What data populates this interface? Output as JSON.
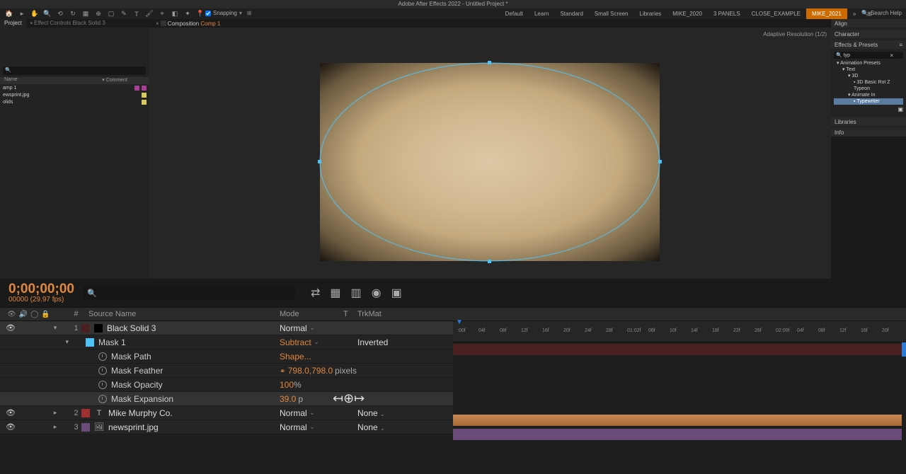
{
  "app": {
    "title": "Adobe After Effects 2022 - Untitled Project *"
  },
  "snapping": {
    "label": "Snapping"
  },
  "workspaces": [
    "Default",
    "Learn",
    "Standard",
    "Small Screen",
    "Libraries",
    "MIKE_2020",
    "3 PANELS",
    "CLOSE_EXAMPLE",
    "MIKE_2021"
  ],
  "search_help": {
    "placeholder": "Search Help"
  },
  "panel_tabs": {
    "project": "Project",
    "effect_controls": "Effect Controls Black Solid 3"
  },
  "comp_tab": {
    "prefix": "Composition",
    "name": "Comp 1"
  },
  "adaptive": "Adaptive Resolution (1/2)",
  "project": {
    "cols": {
      "name": "Name",
      "type": "Comment"
    },
    "items": [
      {
        "name": "amp 1",
        "color": "#a94097"
      },
      {
        "name": "ewsprint.jpg",
        "color": "#d9c85a"
      },
      {
        "name": "olids",
        "color": "#d9c85a"
      }
    ]
  },
  "rcol": {
    "align": "Align",
    "character": "Character",
    "effects": "Effects & Presets",
    "search": "typ",
    "tree": {
      "root": "Animation Presets",
      "text": "Text",
      "threeD": "3D",
      "threeD_item": "3D Basic Rot Z Typeon",
      "animate_in": "Animate In",
      "typewriter": "Typewriter"
    },
    "libraries": "Libraries",
    "info": "Info"
  },
  "timeline_head": {
    "timecode": "0;00;00;00",
    "sub": "00000 (29.97 fps)"
  },
  "col_headers": {
    "num": "#",
    "source": "Source Name",
    "mode": "Mode",
    "t": "T",
    "trkmat": "TrkMat"
  },
  "layers": [
    {
      "num": "1",
      "name": "Black Solid 3",
      "mode": "Normal"
    },
    {
      "mask_name": "Mask 1",
      "mask_mode": "Subtract",
      "inverted": "Inverted"
    }
  ],
  "props": {
    "path": {
      "label": "Mask Path",
      "value": "Shape..."
    },
    "feather": {
      "label": "Mask Feather",
      "value": "798.0,798.0",
      "unit": "pixels"
    },
    "opacity": {
      "label": "Mask Opacity",
      "value": "100",
      "unit": "%"
    },
    "expansion": {
      "label": "Mask Expansion",
      "value": "39.0",
      "unit": "pixels"
    }
  },
  "layers2": [
    {
      "num": "2",
      "name": "Mike Murphy Co.",
      "mode": "Normal",
      "trk": "None"
    },
    {
      "num": "3",
      "name": "newsprint.jpg",
      "mode": "Normal",
      "trk": "None"
    }
  ],
  "ruler_ticks": [
    ":00f",
    "04f",
    "08f",
    "12f",
    "16f",
    "20f",
    "24f",
    "28f",
    "01:02f",
    "06f",
    "10f",
    "14f",
    "18f",
    "22f",
    "26f",
    "02:00f",
    "04f",
    "08f",
    "12f",
    "16f",
    "20f"
  ]
}
